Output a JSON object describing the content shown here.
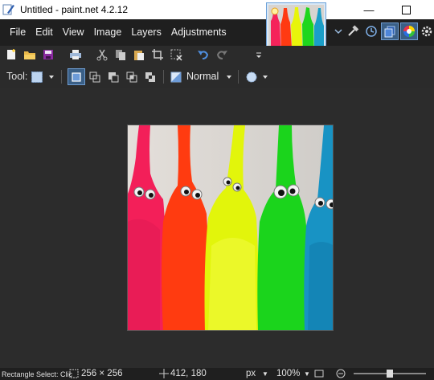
{
  "window": {
    "title": "Untitled - paint.net 4.2.12",
    "minimize_glyph": "—",
    "maximize_glyph": "☐"
  },
  "menu": {
    "items": [
      "File",
      "Edit",
      "View",
      "Image",
      "Layers",
      "Adjustments"
    ]
  },
  "tool_options": {
    "tool_label": "Tool:",
    "blend_mode": "Normal"
  },
  "statusbar": {
    "hint": "Rectangle Select: Clic",
    "selection_size": "256 × 256",
    "cursor_pos": "412, 180",
    "unit": "px",
    "zoom": "100%"
  },
  "colors": {
    "accent": "#3a5f86",
    "menubar_bg": "#1f1f1f",
    "workspace_bg": "#2c2c2c"
  },
  "image": {
    "subject": "five fuzzy worm toys in pink, orange, yellow, green and blue with googly eyes"
  }
}
